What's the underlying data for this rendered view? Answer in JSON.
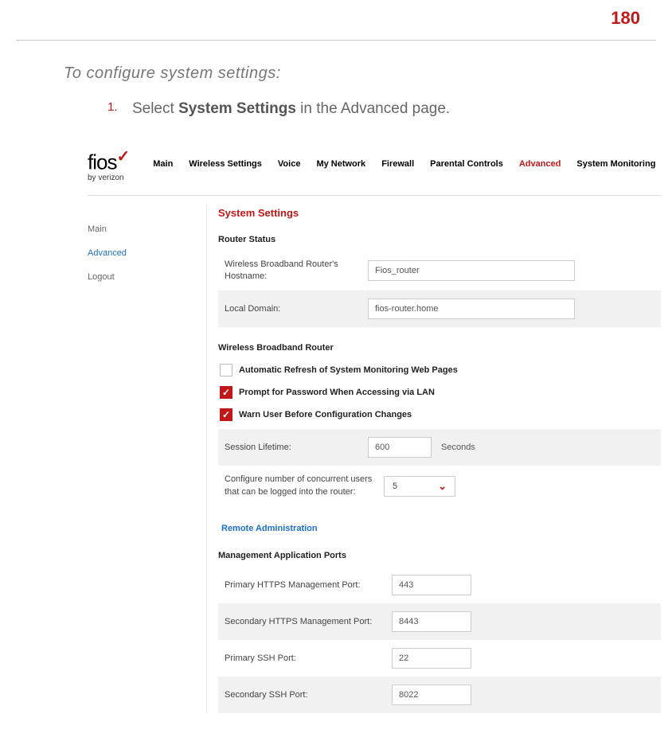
{
  "page_number": "180",
  "intro": "To configure system settings:",
  "step": {
    "number": "1.",
    "prefix": "Select ",
    "bold": "System Settings",
    "suffix": " in the Advanced page."
  },
  "logo": {
    "brand": "fios",
    "tagline": "by verizon"
  },
  "nav": [
    {
      "label": "Main",
      "active": false
    },
    {
      "label": "Wireless Settings",
      "active": false
    },
    {
      "label": "Voice",
      "active": false
    },
    {
      "label": "My Network",
      "active": false
    },
    {
      "label": "Firewall",
      "active": false
    },
    {
      "label": "Parental Controls",
      "active": false
    },
    {
      "label": "Advanced",
      "active": true
    },
    {
      "label": "System Monitoring",
      "active": false
    }
  ],
  "sidebar": [
    {
      "label": "Main",
      "active": false
    },
    {
      "label": "Advanced",
      "active": true
    },
    {
      "label": "Logout",
      "active": false
    }
  ],
  "panel": {
    "title": "System Settings",
    "router_status_h": "Router Status",
    "hostname_label": "Wireless Broadband Router's Hostname:",
    "hostname_value": "Fios_router",
    "local_domain_label": "Local Domain:",
    "local_domain_value": "fios-router.home",
    "wbr_h": "Wireless Broadband Router",
    "cb_auto_refresh": "Automatic Refresh of System Monitoring Web Pages",
    "cb_prompt_pw": "Prompt for Password When Accessing via LAN",
    "cb_warn": "Warn User Before Configuration Changes",
    "session_label": "Session Lifetime:",
    "session_value": "600",
    "session_unit": "Seconds",
    "concurrent_label": "Configure number of concurrent users that can be logged into the router:",
    "concurrent_value": "5",
    "remote_admin": "Remote Administration",
    "mgmt_ports_h": "Management Application Ports",
    "p_https_label": "Primary HTTPS Management Port:",
    "p_https_value": "443",
    "s_https_label": "Secondary HTTPS Management Port:",
    "s_https_value": "8443",
    "p_ssh_label": "Primary SSH Port:",
    "p_ssh_value": "22",
    "s_ssh_label": "Secondary SSH Port:",
    "s_ssh_value": "8022"
  }
}
